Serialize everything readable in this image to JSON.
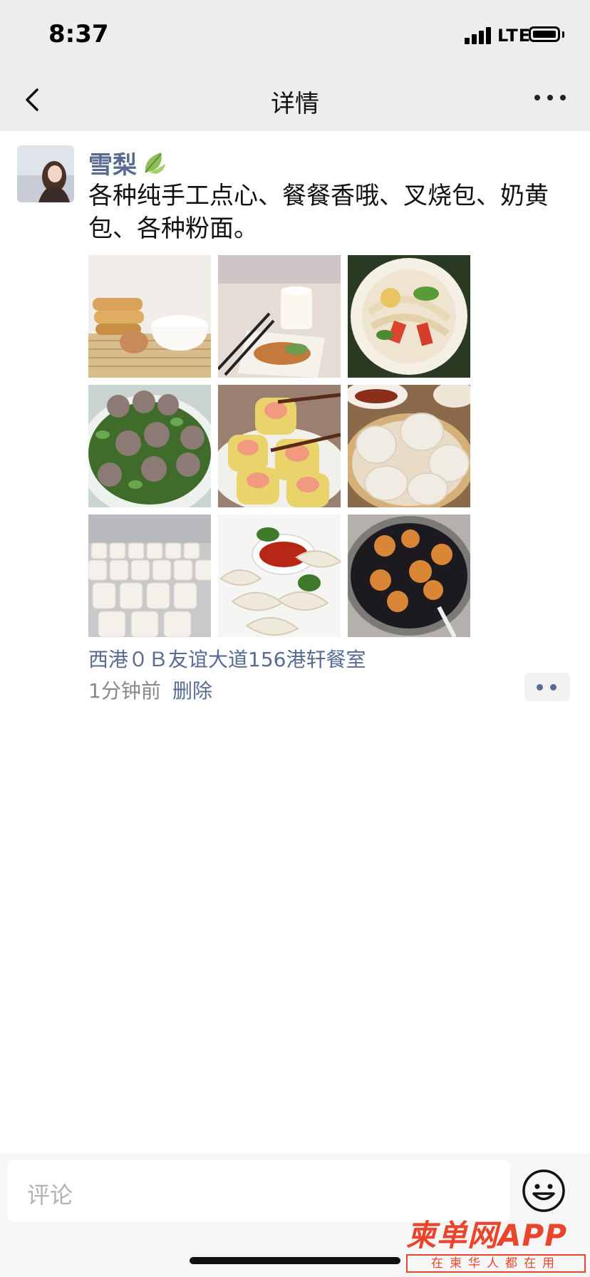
{
  "status_bar": {
    "time": "8:37",
    "network": "LTE"
  },
  "nav": {
    "title": "详情"
  },
  "post": {
    "author": "雪梨",
    "text": "各种纯手工点心、餐餐香哦、叉烧包、奶黄包、各种粉面。",
    "location": "西港０Ｂ友谊大道156港轩餐室",
    "time_ago": "1分钟前",
    "delete_label": "删除"
  },
  "comment": {
    "placeholder": "评论"
  },
  "watermark": {
    "main": "柬单网APP",
    "sub": "在柬华人都在用"
  },
  "colors": {
    "link": "#576b95",
    "header_bg": "#ededed",
    "watermark": "#e8452c"
  }
}
